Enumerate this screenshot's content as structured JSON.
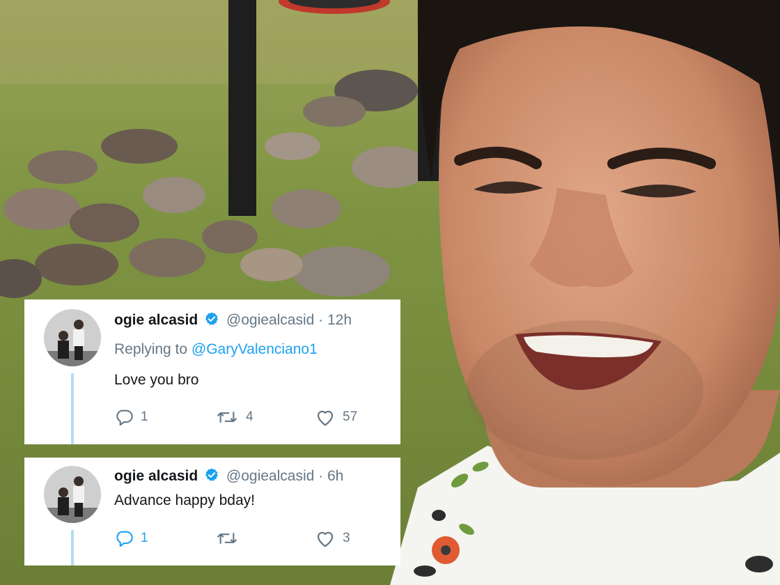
{
  "tweets": [
    {
      "display_name": "ogie alcasid",
      "handle": "@ogiealcasid",
      "separator": "·",
      "time": "12h",
      "replying_prefix": "Replying to ",
      "replying_to": "@GaryValenciano1",
      "text": "Love you bro",
      "reply_count": "1",
      "retweet_count": "4",
      "like_count": "57"
    },
    {
      "display_name": "ogie alcasid",
      "handle": "@ogiealcasid",
      "separator": "·",
      "time": "6h",
      "text": "Advance happy bday!",
      "reply_count": "1",
      "retweet_count": "",
      "like_count": "3"
    }
  ],
  "icons": [
    "verified-badge-icon",
    "reply-icon",
    "retweet-icon",
    "like-icon"
  ],
  "colors": {
    "link": "#1da1f2",
    "muted": "#657786",
    "text": "#14171a",
    "thread": "#b5dbee"
  }
}
